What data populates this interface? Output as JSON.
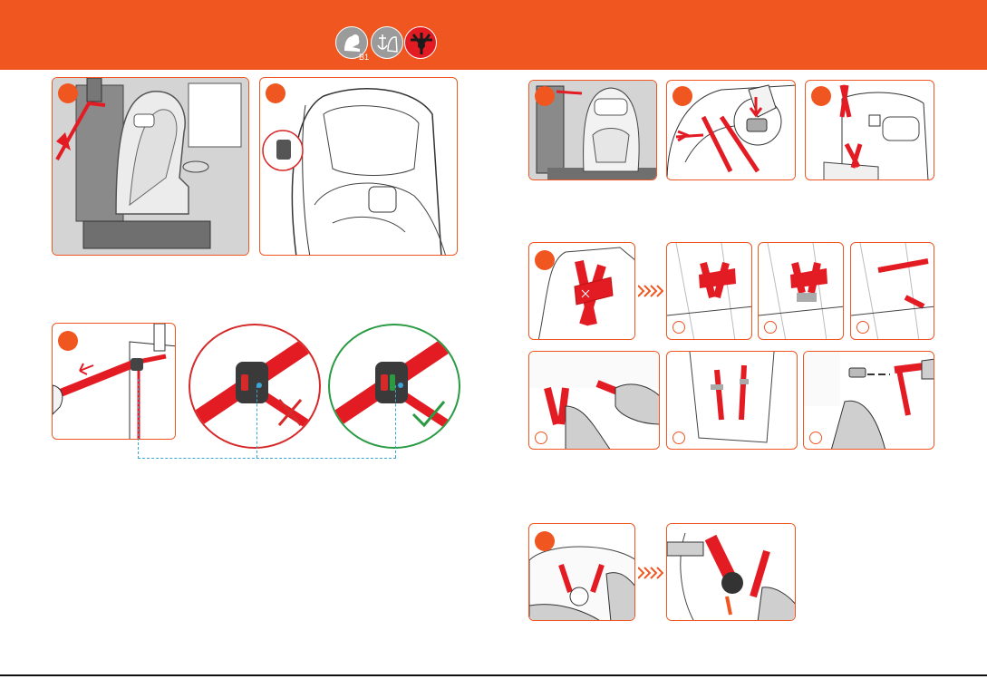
{
  "header": {
    "color": "#f05620",
    "badges": [
      {
        "icon": "child-seat-group-icon",
        "label": "B1"
      },
      {
        "icon": "isofix-anchor-icon",
        "label": ""
      },
      {
        "icon": "five-point-harness-icon",
        "label": ""
      }
    ]
  },
  "colors": {
    "accent": "#f05620",
    "strap": "#e31b23",
    "wrong": "#d62a2a",
    "right": "#2a9a43",
    "guide": "#3aa6d8"
  }
}
